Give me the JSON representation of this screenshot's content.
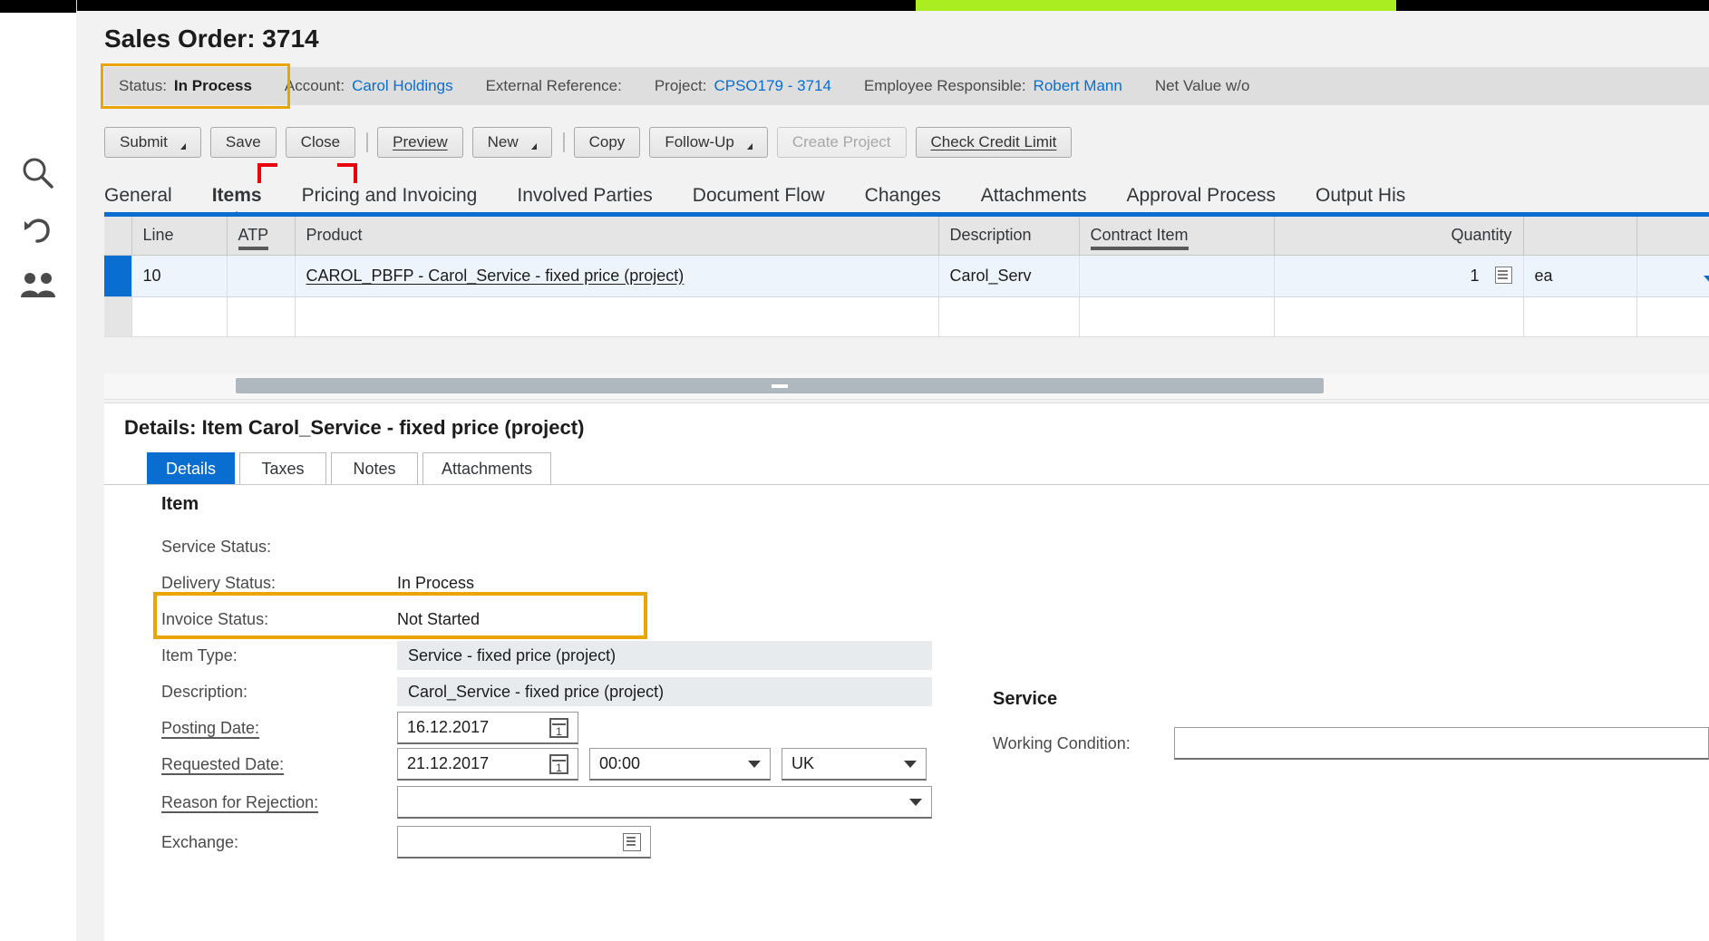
{
  "window": {
    "title": "Sales Order: 3714"
  },
  "header": {
    "fields": [
      {
        "label": "Status:",
        "value": "In Process",
        "style": "bold",
        "name": "status"
      },
      {
        "label": "Account:",
        "value": "Carol Holdings",
        "style": "link",
        "name": "account"
      },
      {
        "label": "External Reference:",
        "value": "",
        "style": "plain",
        "name": "external-reference"
      },
      {
        "label": "Project:",
        "value": "CPSO179 - 3714",
        "style": "link",
        "name": "project"
      },
      {
        "label": "Employee Responsible:",
        "value": "Robert Mann",
        "style": "link",
        "name": "employee-responsible"
      },
      {
        "label": "Net Value w/o",
        "value": "",
        "style": "plain",
        "name": "net-value"
      }
    ]
  },
  "toolbar": {
    "buttons": [
      {
        "label": "Submit",
        "caret": true,
        "disabled": false,
        "underline": false,
        "name": "submit-button"
      },
      {
        "label": "Save",
        "caret": false,
        "disabled": false,
        "underline": false,
        "name": "save-button"
      },
      {
        "label": "Close",
        "caret": false,
        "disabled": false,
        "underline": false,
        "name": "close-button"
      },
      {
        "sep": true
      },
      {
        "label": "Preview",
        "caret": false,
        "disabled": false,
        "underline": true,
        "name": "preview-button"
      },
      {
        "label": "New",
        "caret": true,
        "disabled": false,
        "underline": false,
        "name": "new-button"
      },
      {
        "sep": true
      },
      {
        "label": "Copy",
        "caret": false,
        "disabled": false,
        "underline": false,
        "name": "copy-button"
      },
      {
        "label": "Follow-Up",
        "caret": true,
        "disabled": false,
        "underline": false,
        "name": "follow-up-button"
      },
      {
        "label": "Create Project",
        "caret": false,
        "disabled": true,
        "underline": false,
        "name": "create-project-button"
      },
      {
        "label": "Check Credit Limit",
        "caret": false,
        "disabled": false,
        "underline": true,
        "name": "check-credit-limit-button"
      }
    ]
  },
  "tabs": {
    "items": [
      {
        "label": "General",
        "active": false
      },
      {
        "label": "Items",
        "active": true
      },
      {
        "label": "Pricing and Invoicing",
        "active": false
      },
      {
        "label": "Involved Parties",
        "active": false
      },
      {
        "label": "Document Flow",
        "active": false
      },
      {
        "label": "Changes",
        "active": false
      },
      {
        "label": "Attachments",
        "active": false
      },
      {
        "label": "Approval Process",
        "active": false
      },
      {
        "label": "Output His",
        "active": false
      }
    ]
  },
  "items_table": {
    "columns": [
      {
        "label": "Line",
        "align": "left",
        "sorted": false
      },
      {
        "label": "ATP",
        "align": "left",
        "sorted": true
      },
      {
        "label": "Product",
        "align": "left",
        "sorted": false
      },
      {
        "label": "Description",
        "align": "left",
        "sorted": false
      },
      {
        "label": "Contract Item",
        "align": "left",
        "sorted": true
      },
      {
        "label": "Quantity",
        "align": "right",
        "sorted": false
      },
      {
        "label": "",
        "align": "left",
        "sorted": false
      }
    ],
    "rows": [
      {
        "selected": true,
        "line": "10",
        "atp": "",
        "product": "CAROL_PBFP - Carol_Service - fixed price (project)",
        "description": "Carol_Serv",
        "contract_item": "",
        "quantity": "1",
        "uom": "ea"
      }
    ]
  },
  "details": {
    "title": "Details: Item Carol_Service - fixed price (project)",
    "subtabs": [
      {
        "label": "Details",
        "active": true
      },
      {
        "label": "Taxes",
        "active": false
      },
      {
        "label": "Notes",
        "active": false
      },
      {
        "label": "Attachments",
        "active": false
      }
    ],
    "item_section_title": "Item",
    "service_section_title": "Service",
    "fields": [
      {
        "label": "Service Status:",
        "value": "",
        "kind": "text",
        "required": false,
        "name": "service-status"
      },
      {
        "label": "Delivery Status:",
        "value": "In Process",
        "kind": "text",
        "required": false,
        "name": "delivery-status"
      },
      {
        "label": "Invoice Status:",
        "value": "Not Started",
        "kind": "text",
        "required": false,
        "name": "invoice-status"
      },
      {
        "label": "Item Type:",
        "value": "Service - fixed price (project)",
        "kind": "readonly",
        "required": false,
        "name": "item-type"
      },
      {
        "label": "Description:",
        "value": "Carol_Service - fixed price (project)",
        "kind": "readonly",
        "required": false,
        "name": "item-description"
      },
      {
        "label": "Posting Date:",
        "value": "16.12.2017",
        "kind": "date",
        "required": true,
        "name": "posting-date"
      },
      {
        "label": "Requested Date:",
        "value": "21.12.2017",
        "kind": "datetime",
        "required": true,
        "name": "requested-date",
        "time": "00:00",
        "country": "UK"
      },
      {
        "label": "Reason for Rejection:",
        "value": "",
        "kind": "select",
        "required": true,
        "name": "reason-for-rejection"
      },
      {
        "label": "Exchange:",
        "value": "",
        "kind": "valuehelp",
        "required": false,
        "name": "exchange"
      }
    ],
    "service_fields": [
      {
        "label": "Working Condition:",
        "value": "",
        "kind": "input",
        "name": "working-condition"
      }
    ]
  },
  "sidebar": {
    "icons": [
      {
        "name": "search-icon"
      },
      {
        "name": "undo-icon"
      },
      {
        "name": "people-icon"
      }
    ]
  },
  "colors": {
    "accent": "#0a6ed1",
    "highlight": "#eba400",
    "focus": "#e8000d",
    "header_strip": "#dedede",
    "row_selected": "#eef4fb"
  }
}
